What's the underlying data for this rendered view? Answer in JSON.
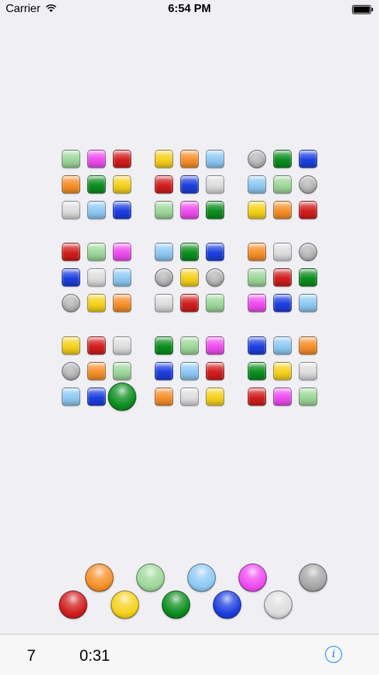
{
  "status_bar": {
    "carrier": "Carrier",
    "time": "6:54 PM"
  },
  "colors": {
    "mint": "#9ed89a",
    "magenta": "#f04cf0",
    "red": "#d21e1e",
    "orange": "#f7902a",
    "green": "#0c8e1f",
    "yellow": "#f6d21c",
    "white": "#dedede",
    "lightblue": "#8fcaf4",
    "blue": "#1d3fe0",
    "gray": "#a8a8a8"
  },
  "board": [
    [
      "mint",
      "magenta",
      "red",
      "yellow",
      "orange",
      "lightblue",
      "empty",
      "green",
      "blue"
    ],
    [
      "orange",
      "green",
      "yellow",
      "red",
      "blue",
      "white",
      "lightblue",
      "mint",
      "empty"
    ],
    [
      "white",
      "lightblue",
      "blue",
      "mint",
      "magenta",
      "green",
      "yellow",
      "orange",
      "red"
    ],
    [
      "red",
      "mint",
      "magenta",
      "lightblue",
      "green",
      "blue",
      "orange",
      "white",
      "empty"
    ],
    [
      "blue",
      "white",
      "lightblue",
      "empty",
      "yellow",
      "empty",
      "mint",
      "red",
      "green"
    ],
    [
      "empty",
      "yellow",
      "orange",
      "white",
      "red",
      "mint",
      "magenta",
      "blue",
      "lightblue"
    ],
    [
      "yellow",
      "red",
      "white",
      "green",
      "mint",
      "magenta",
      "blue",
      "lightblue",
      "orange"
    ],
    [
      "empty",
      "orange",
      "mint",
      "blue",
      "lightblue",
      "red",
      "green",
      "yellow",
      "white"
    ],
    [
      "lightblue",
      "blue",
      "empty",
      "orange",
      "white",
      "yellow",
      "red",
      "magenta",
      "mint"
    ]
  ],
  "selected_cell": {
    "row": 8,
    "col": 2,
    "color": "green"
  },
  "palette": [
    "red",
    "orange",
    "yellow",
    "mint",
    "green",
    "lightblue",
    "blue",
    "magenta",
    "white",
    "gray"
  ],
  "footer": {
    "count": "7",
    "timer": "0:31",
    "info_icon": "info-icon"
  }
}
